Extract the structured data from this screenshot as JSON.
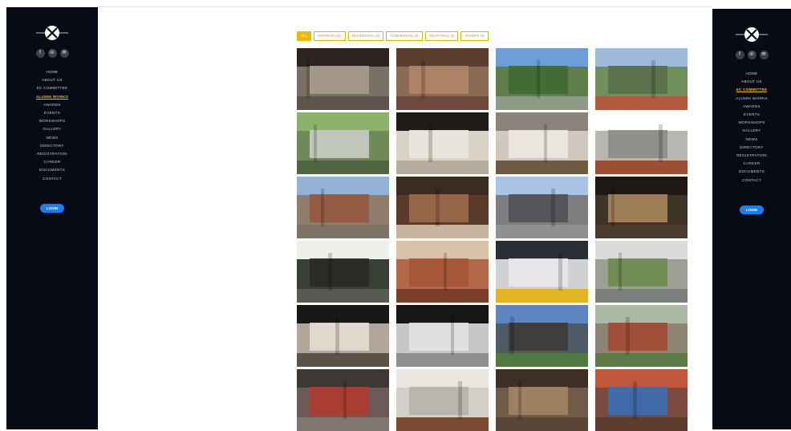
{
  "sidebar_left": {
    "brand": "logo",
    "socials": [
      {
        "icon": "facebook-icon",
        "glyph": "f"
      },
      {
        "icon": "whatsapp-icon",
        "glyph": "☏"
      },
      {
        "icon": "mail-icon",
        "glyph": "✉"
      }
    ],
    "nav": [
      "HOME",
      "ABOUT US",
      "EC COMMITTEE",
      "ALUMNI WORKS",
      "AWARDS",
      "EVENTS",
      "WORKSHOPS",
      "GALLERY",
      "NEWS",
      "DIRECTORY",
      "REGISTRATION",
      "CAREER",
      "DOCUMENTS",
      "CONTACT"
    ],
    "active": "ALUMNI WORKS",
    "login": "LOGIN"
  },
  "sidebar_right": {
    "nav": [
      "HOME",
      "ABOUT US",
      "EC COMMITTEE",
      "ALUMNI WORKS",
      "AWARDS",
      "EVENTS",
      "WORKSHOPS",
      "GALLERY",
      "NEWS",
      "DIRECTORY",
      "REGISTRATION",
      "CAREER",
      "DOCUMENTS",
      "CONTACT"
    ],
    "active": "EC COMMITTEE",
    "login": "LOGIN"
  },
  "filters": [
    {
      "label": "ALL",
      "active": true
    },
    {
      "label": "INTERIOR (32)",
      "active": false
    },
    {
      "label": "RESIDENTIAL (8)",
      "active": false
    },
    {
      "label": "COMMERCIAL (2)",
      "active": false
    },
    {
      "label": "INDUSTRIAL (5)",
      "active": false
    },
    {
      "label": "OTHERS (9)",
      "active": false
    }
  ],
  "colors": {
    "sidebar_bg": "#060b16",
    "accent": "#f2b705",
    "login_button": "#1d7df2"
  },
  "gallery": [
    {
      "bg": "#7b7066",
      "top": "#2b2420",
      "mid": "#a89c8e",
      "bot": "#5c544d"
    },
    {
      "bg": "#8c6b55",
      "top": "#5a3f30",
      "mid": "#b0866a",
      "bot": "#6e4a3e"
    },
    {
      "bg": "#5e7f4a",
      "top": "#6d9fd6",
      "mid": "#3f6a34",
      "bot": "#8d9a86"
    },
    {
      "bg": "#6f8f5b",
      "top": "#9dbad8",
      "mid": "#59704a",
      "bot": "#b25a3e"
    },
    {
      "bg": "#6d8a58",
      "top": "#8eb16a",
      "mid": "#c9ccc4",
      "bot": "#4f6640"
    },
    {
      "bg": "#d7d1c6",
      "top": "#1f1b18",
      "mid": "#ece7dc",
      "bot": "#b7ad9f"
    },
    {
      "bg": "#cfc9bd",
      "top": "#8c8279",
      "mid": "#ece8e1",
      "bot": "#6f5a44"
    },
    {
      "bg": "#b7b6b1",
      "top": "#ffffff",
      "mid": "#8d8b86",
      "bot": "#9c4f33"
    },
    {
      "bg": "#8e7c6c",
      "top": "#92b3d6",
      "mid": "#955a3f",
      "bot": "#7d7264"
    },
    {
      "bg": "#5a3a28",
      "top": "#3b2b20",
      "mid": "#9c6b4b",
      "bot": "#c8b5a0"
    },
    {
      "bg": "#7e7e80",
      "top": "#a8c3e6",
      "mid": "#505054",
      "bot": "#909090"
    },
    {
      "bg": "#3e3428",
      "top": "#1d1814",
      "mid": "#a7865c",
      "bot": "#4a3c2c"
    },
    {
      "bg": "#3a3f35",
      "top": "#eef0ec",
      "mid": "#2a2a26",
      "bot": "#595b53"
    },
    {
      "bg": "#b36849",
      "top": "#d8c3a8",
      "mid": "#a45535",
      "bot": "#7a3f29"
    },
    {
      "bg": "#cfd1d3",
      "top": "#2a2e34",
      "mid": "#e8e8ea",
      "bot": "#e3b421"
    },
    {
      "bg": "#9b9f96",
      "top": "#d9dcdb",
      "mid": "#6b8b4e",
      "bot": "#7d7f7c"
    },
    {
      "bg": "#b2a79a",
      "top": "#1a1816",
      "mid": "#e6ddd1",
      "bot": "#5b5249"
    },
    {
      "bg": "#c5c7c8",
      "top": "#161616",
      "mid": "#e0e2e3",
      "bot": "#8e8f90"
    },
    {
      "bg": "#4e5b66",
      "top": "#5d86c0",
      "mid": "#3e3b38",
      "bot": "#4f7a3f"
    },
    {
      "bg": "#8a8470",
      "top": "#aeb9a5",
      "mid": "#a24a33",
      "bot": "#5f7a49"
    },
    {
      "bg": "#6b5a55",
      "top": "#3d3835",
      "mid": "#b03a2e",
      "bot": "#807670"
    },
    {
      "bg": "#d2cfc8",
      "top": "#e9e6e0",
      "mid": "#b8b3aa",
      "bot": "#7a4b2f"
    },
    {
      "bg": "#6f5b48",
      "top": "#3e2f24",
      "mid": "#a08464",
      "bot": "#5a4636"
    },
    {
      "bg": "#7b4a3e",
      "top": "#c2563a",
      "mid": "#3b6fb4",
      "bot": "#5e3b2f"
    }
  ]
}
